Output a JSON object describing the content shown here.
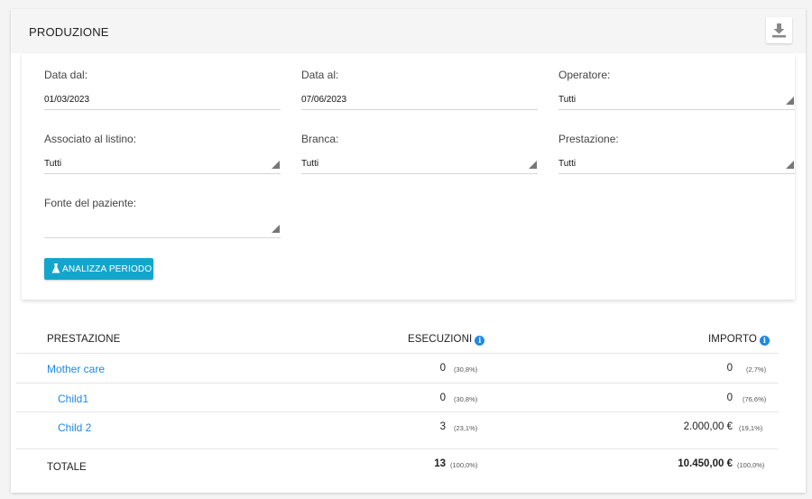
{
  "panel": {
    "title": "PRODUZIONE"
  },
  "filters": {
    "data_dal": {
      "label": "Data dal:",
      "value": "01/03/2023"
    },
    "data_al": {
      "label": "Data al:",
      "value": "07/06/2023"
    },
    "operatore": {
      "label": "Operatore:",
      "value": "Tutti"
    },
    "associato": {
      "label": "Associato al listino:",
      "value": "Tutti"
    },
    "branca": {
      "label": "Branca:",
      "value": "Tutti"
    },
    "prestazione": {
      "label": "Prestazione:",
      "value": "Tutti"
    },
    "fonte": {
      "label": "Fonte del paziente:",
      "value": ""
    }
  },
  "analyze_button": {
    "label": "ANALIZZA PERIODO"
  },
  "table": {
    "headers": {
      "prestazione": "PRESTAZIONE",
      "esecuzioni": "ESECUZIONI",
      "importo": "IMPORTO"
    },
    "info_glyph": "i",
    "rows": [
      {
        "name": "Mother care",
        "esecuzioni": "0",
        "esecuzioni_pct": "(30,8%)",
        "importo": "0",
        "importo_pct": "(2,7%)"
      },
      {
        "name": "Child1",
        "esecuzioni": "0",
        "esecuzioni_pct": "(30,8%)",
        "importo": "0",
        "importo_pct": "(76,6%)"
      },
      {
        "name": "Child 2",
        "esecuzioni": "3",
        "esecuzioni_pct": "(23,1%)",
        "importo": "2.000,00 €",
        "importo_pct": "(19,1%)"
      }
    ],
    "total": {
      "label": "TOTALE",
      "esecuzioni": "13",
      "esecuzioni_pct": "(100,0%)",
      "importo": "10.450,00 €",
      "importo_pct": "(100,0%)"
    }
  },
  "colors": {
    "accent": "#13a6cc",
    "link": "#1e88e5"
  },
  "icons": {
    "download": "download-icon",
    "flask": "flask-icon",
    "info": "info-icon",
    "caret": "dropdown-caret-icon"
  }
}
